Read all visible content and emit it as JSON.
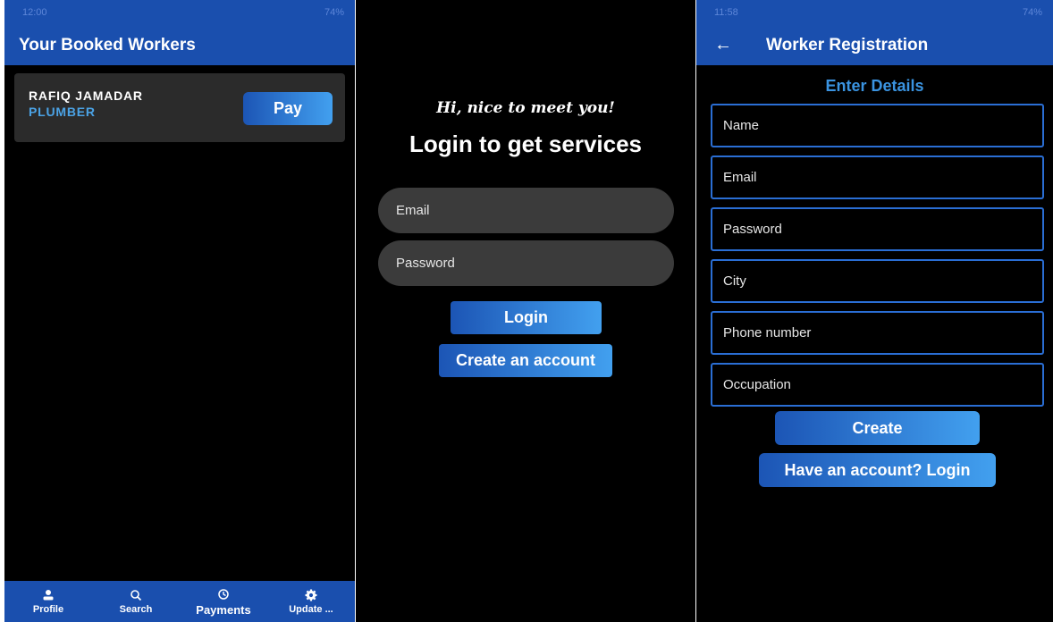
{
  "booked": {
    "status_time": "12:00",
    "status_right": "74%",
    "title": "Your Booked Workers",
    "worker": {
      "name": "RAFIQ JAMADAR",
      "role": "PLUMBER",
      "pay_label": "Pay"
    },
    "nav": [
      {
        "label": "Profile",
        "icon": "person-icon"
      },
      {
        "label": "Search",
        "icon": "search-icon"
      },
      {
        "label": "Payments",
        "icon": "history-icon"
      },
      {
        "label": "Update ...",
        "icon": "gear-icon"
      }
    ]
  },
  "login": {
    "greeting": "Hi, nice to meet you!",
    "title": "Login to get services",
    "email_placeholder": "Email",
    "password_placeholder": "Password",
    "login_label": "Login",
    "create_label": "Create an account"
  },
  "registration": {
    "status_time": "11:58",
    "status_right": "74%",
    "title": "Worker Registration",
    "subtitle": "Enter Details",
    "fields": [
      "Name",
      "Email",
      "Password",
      "City",
      "Phone number",
      "Occupation"
    ],
    "create_label": "Create",
    "login_label": "Have an account? Login"
  },
  "colors": {
    "appbar": "#1a4fae",
    "accent": "#3a93e0",
    "button_start": "#1c55b5",
    "button_end": "#42a0ef"
  }
}
